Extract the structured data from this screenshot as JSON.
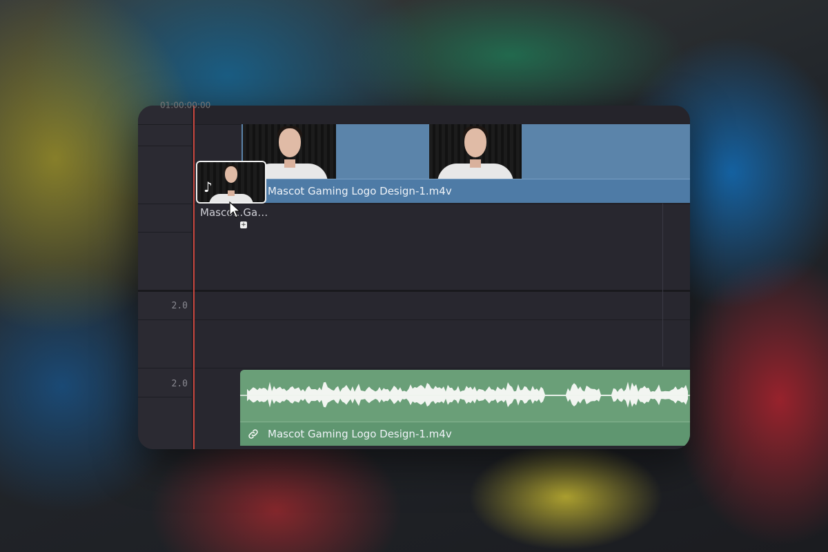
{
  "timeline": {
    "header_timecode": "01:00:00:00",
    "video_track": {
      "clip_name": "Mascot Gaming Logo Design-1.m4v"
    },
    "dragged_clip": {
      "label": "Masco…Ga…"
    },
    "audio_tracks": [
      {
        "channel": "2.0"
      },
      {
        "channel": "2.0",
        "clip_name": "Mascot Gaming Logo Design-1.m4v"
      }
    ]
  },
  "colors": {
    "video_clip": "#5b84aa",
    "audio_clip": "#6a9f78",
    "playhead": "#c8453c",
    "timeline_bg": "#28272f"
  },
  "icons": [
    "music-note-icon",
    "link-icon",
    "mouse-cursor-icon",
    "add-badge-icon"
  ]
}
